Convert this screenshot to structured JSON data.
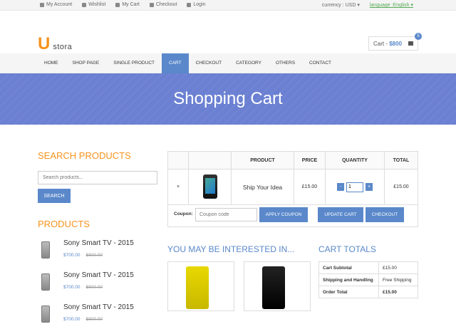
{
  "topbar": {
    "links": [
      "My Account",
      "Wishlist",
      "My Cart",
      "Checkout",
      "Login"
    ],
    "currency_label": "currency :",
    "currency_value": "USD",
    "language_label": "language :",
    "language_value": "English"
  },
  "brand": {
    "letter": "U",
    "name": "stora"
  },
  "cart": {
    "label": "Cart - ",
    "amount": "$800",
    "count": "5"
  },
  "nav": [
    "HOME",
    "SHOP PAGE",
    "SINGLE PRODUCT",
    "CART",
    "CHECKOUT",
    "CATEGORY",
    "OTHERS",
    "CONTACT"
  ],
  "banner": {
    "title": "Shopping Cart"
  },
  "sidebar": {
    "search_title": "SEARCH PRODUCTS",
    "search_placeholder": "Search products...",
    "search_button": "SEARCH",
    "products_title": "PRODUCTS",
    "products": [
      {
        "name": "Sony Smart TV - 2015",
        "price": "$700.00",
        "old_price": "$800.00"
      },
      {
        "name": "Sony Smart TV - 2015",
        "price": "$700.00",
        "old_price": "$800.00"
      },
      {
        "name": "Sony Smart TV - 2015",
        "price": "$700.00",
        "old_price": "$800.00"
      }
    ]
  },
  "cart_table": {
    "headers": [
      "",
      "",
      "PRODUCT",
      "PRICE",
      "QUANTITY",
      "TOTAL"
    ],
    "rows": [
      {
        "remove": "×",
        "product": "Ship Your Idea",
        "price": "£15.00",
        "qty": "1",
        "total": "£15.00"
      }
    ],
    "coupon_label": "Coupon:",
    "coupon_placeholder": "Coupon code",
    "apply_coupon": "APPLY COUPON",
    "update_cart": "UPDATE CART",
    "checkout": "CHECKOUT"
  },
  "interested_title": "YOU MAY BE INTERESTED IN...",
  "totals": {
    "title": "CART TOTALS",
    "rows": [
      {
        "label": "Cart Subtotal",
        "value": "£15.00"
      },
      {
        "label": "Shipping and Handling",
        "value": "Free Shipping"
      },
      {
        "label": "Order Total",
        "value": "£15.00"
      }
    ]
  },
  "colors": {
    "accent": "#5a88ca",
    "orange": "#f7931e",
    "banner": "#6b80d2"
  }
}
